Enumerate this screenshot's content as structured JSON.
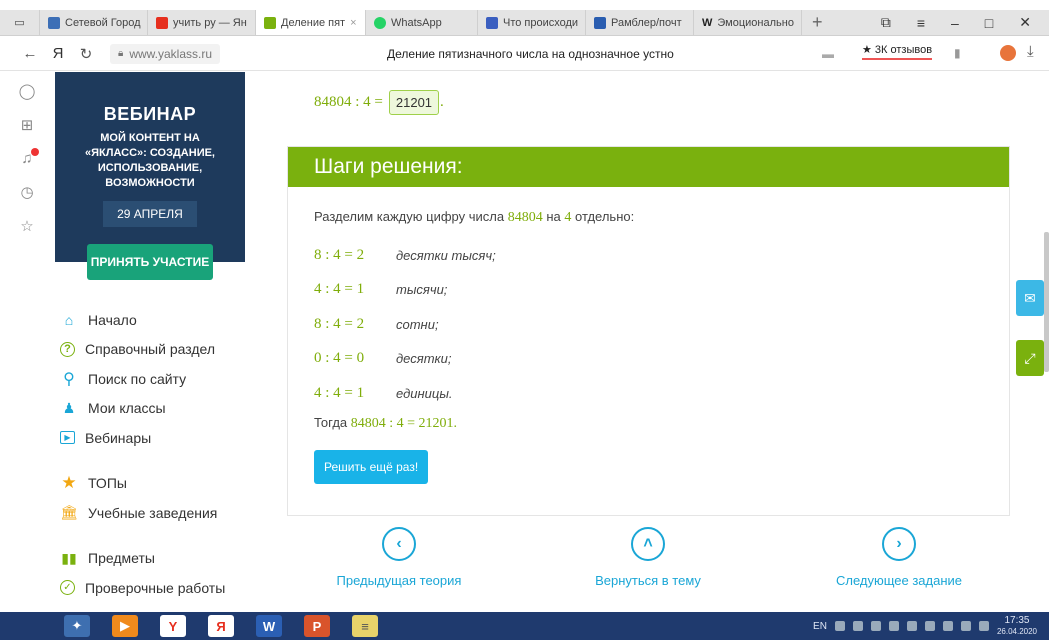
{
  "browser": {
    "tabs": [
      {
        "label": "Сетевой Город",
        "color": "#3d6fb6"
      },
      {
        "label": "учить ру — Ян",
        "color": "#e62f1e"
      },
      {
        "label": "Деление пят",
        "color": "#7ab10e",
        "active": true
      },
      {
        "label": "WhatsApp",
        "color": "#25d366"
      },
      {
        "label": "Что происходи",
        "color": "#3b5fc0"
      },
      {
        "label": "Рамблер/почт",
        "color": "#2a5db0"
      },
      {
        "label": "Эмоционально",
        "color": "#222222"
      }
    ],
    "address": "www.yaklass.ru",
    "page_title": "Деление пятизначного числа на однозначное устно",
    "reviews": "★ 3К отзывов"
  },
  "banner": {
    "title": "ВЕБИНАР",
    "description": "МОЙ КОНТЕНТ НА «ЯКЛАСС»: СОЗДАНИЕ, ИСПОЛЬЗОВАНИЕ, ВОЗМОЖНОСТИ",
    "date": "29 АПРЕЛЯ",
    "button": "ПРИНЯТЬ УЧАСТИЕ"
  },
  "nav": {
    "items": [
      {
        "label": "Начало",
        "icon": "home-icon"
      },
      {
        "label": "Справочный раздел",
        "icon": "help-icon"
      },
      {
        "label": "Поиск по сайту",
        "icon": "search-icon"
      },
      {
        "label": "Мои классы",
        "icon": "classes-icon"
      },
      {
        "label": "Вебинары",
        "icon": "webinar-icon"
      },
      {
        "label": "ТОПы",
        "icon": "star-icon"
      },
      {
        "label": "Учебные заведения",
        "icon": "institution-icon"
      },
      {
        "label": "Предметы",
        "icon": "books-icon"
      },
      {
        "label": "Проверочные работы",
        "icon": "check-icon"
      }
    ]
  },
  "answer": {
    "expression": "84804 : 4 =",
    "value": "21201",
    "suffix": "."
  },
  "solution": {
    "heading": "Шаги решения:",
    "intro_before": "Разделим каждую цифру числа",
    "intro_number": "84804",
    "intro_mid": "на",
    "intro_divisor": "4",
    "intro_after": "отдельно:",
    "steps": [
      {
        "expr": "8 : 4 = 2",
        "word": "десятки тысяч;"
      },
      {
        "expr": "4 : 4 = 1",
        "word": "тысячи;"
      },
      {
        "expr": "8 : 4 = 2",
        "word": "сотни;"
      },
      {
        "expr": "0 : 4 = 0",
        "word": "десятки;"
      },
      {
        "expr": "4 : 4 = 1",
        "word": "единицы."
      }
    ],
    "total_prefix": "Тогда",
    "total_expr": "84804 : 4 = 21201.",
    "retry": "Решить ещё раз!"
  },
  "bottom_nav": {
    "prev": "Предыдущая теория",
    "back": "Вернуться в тему",
    "next": "Следующее задание"
  },
  "taskbar": {
    "lang": "EN",
    "time": "17:35",
    "date": "26.04.2020"
  }
}
